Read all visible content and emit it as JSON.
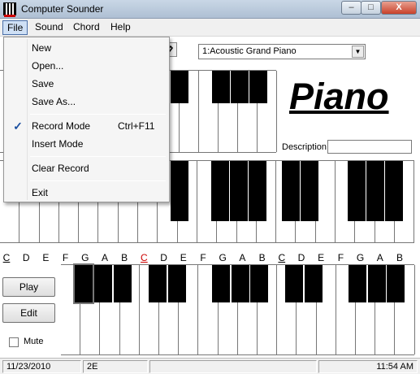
{
  "window": {
    "title": "Computer Sounder",
    "buttons": [
      "–",
      "□",
      "X"
    ]
  },
  "menubar": {
    "items": [
      "File",
      "Sound",
      "Chord",
      "Help"
    ],
    "active": "File"
  },
  "file_menu": {
    "items": [
      {
        "label": "New",
        "shortcut": "",
        "checked": false
      },
      {
        "label": "Open...",
        "shortcut": "",
        "checked": false
      },
      {
        "label": "Save",
        "shortcut": "",
        "checked": false
      },
      {
        "label": "Save As...",
        "shortcut": "",
        "checked": false
      },
      {
        "label": "Record Mode",
        "shortcut": "Ctrl+F11",
        "checked": true
      },
      {
        "label": "Insert Mode",
        "shortcut": "",
        "checked": false
      },
      {
        "label": "Clear Record",
        "shortcut": "",
        "checked": false
      },
      {
        "label": "Exit",
        "shortcut": "",
        "checked": false
      }
    ]
  },
  "instrument": {
    "selected": "1:Acoustic Grand Piano",
    "heading": "Piano"
  },
  "description": {
    "label": "Description:",
    "value": ""
  },
  "note_labels": [
    "C",
    "D",
    "E",
    "F",
    "G",
    "A",
    "B",
    "C",
    "D",
    "E",
    "F",
    "G",
    "A",
    "B",
    "C",
    "D",
    "E",
    "F",
    "G",
    "A",
    "B"
  ],
  "controls": {
    "play": "Play",
    "edit": "Edit",
    "mute": "Mute",
    "mute_checked": false
  },
  "status": {
    "date": "11/23/2010",
    "note": "2E",
    "middle": "",
    "time": "11:54 AM"
  },
  "colors": {
    "accent": "#1a4fa0",
    "highlight_note": "#cc0000"
  }
}
